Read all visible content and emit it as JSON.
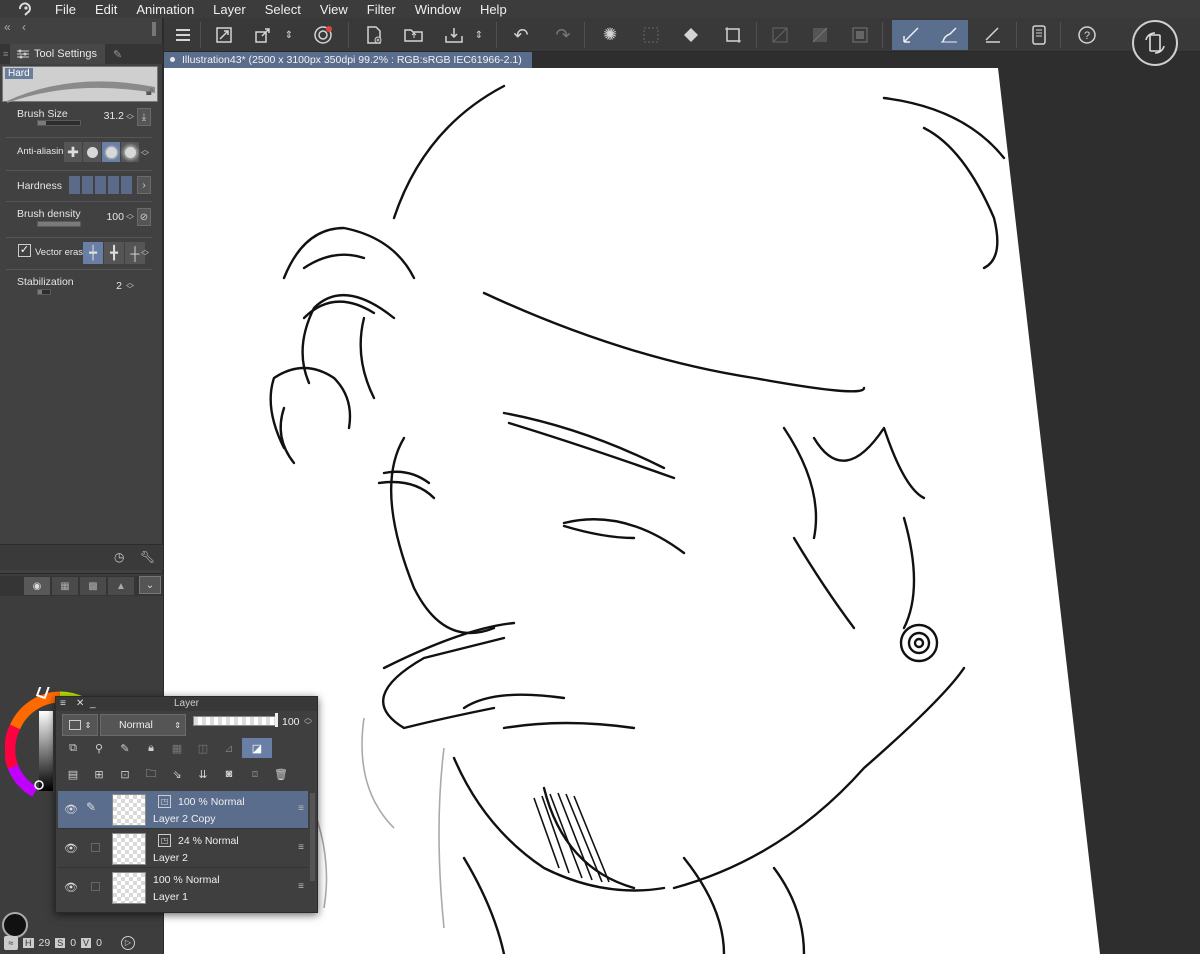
{
  "menubar": {
    "logo_icon": "clip-studio-logo-icon",
    "items": [
      "File",
      "Edit",
      "Animation",
      "Layer",
      "Select",
      "View",
      "Filter",
      "Window",
      "Help"
    ]
  },
  "toolbar": {
    "icons": [
      "hamburger-menu-icon",
      "fit-canvas-icon",
      "transform-icon",
      "spiral-icon",
      "new-file-icon",
      "open-file-icon",
      "save-icon",
      "undo-icon",
      "redo-icon",
      "loading-icon",
      "deselect-icon",
      "fill-icon",
      "crop-icon",
      "clear-icon",
      "ruler-icon",
      "tablet-icon",
      "help-icon",
      "sync-icon"
    ],
    "accent_color": "#5a6e8e"
  },
  "tool_settings": {
    "tab_label": "Tool Settings",
    "brush_label": "Hard",
    "brush_size": {
      "label": "Brush Size",
      "value": "31.2"
    },
    "anti_aliasing": {
      "label": "Anti-aliasing"
    },
    "hardness": {
      "label": "Hardness"
    },
    "brush_density": {
      "label": "Brush density",
      "value": "100"
    },
    "vector_eraser": {
      "label": "Vector eraser",
      "checked": true
    },
    "stabilization": {
      "label": "Stabilization",
      "value": "2"
    }
  },
  "canvas": {
    "doc_title": "Illustration43* (2500 x 3100px 350dpi 99.2% : RGB:sRGB IEC61966-2.1)"
  },
  "status": {
    "s_value": "29",
    "v_value": "0",
    "last_value": "0"
  },
  "layer_panel": {
    "title": "Layer",
    "blend_mode": "Normal",
    "opacity": "100",
    "layers": [
      {
        "opacity_mode": "100 %  Normal",
        "name": "Layer 2 Copy",
        "selected": true,
        "vector": true,
        "editing": true
      },
      {
        "opacity_mode": "24 %  Normal",
        "name": "Layer 2",
        "selected": false,
        "vector": true,
        "editing": false
      },
      {
        "opacity_mode": "100 %  Normal",
        "name": "Layer 1",
        "selected": false,
        "vector": false,
        "editing": false
      }
    ]
  }
}
